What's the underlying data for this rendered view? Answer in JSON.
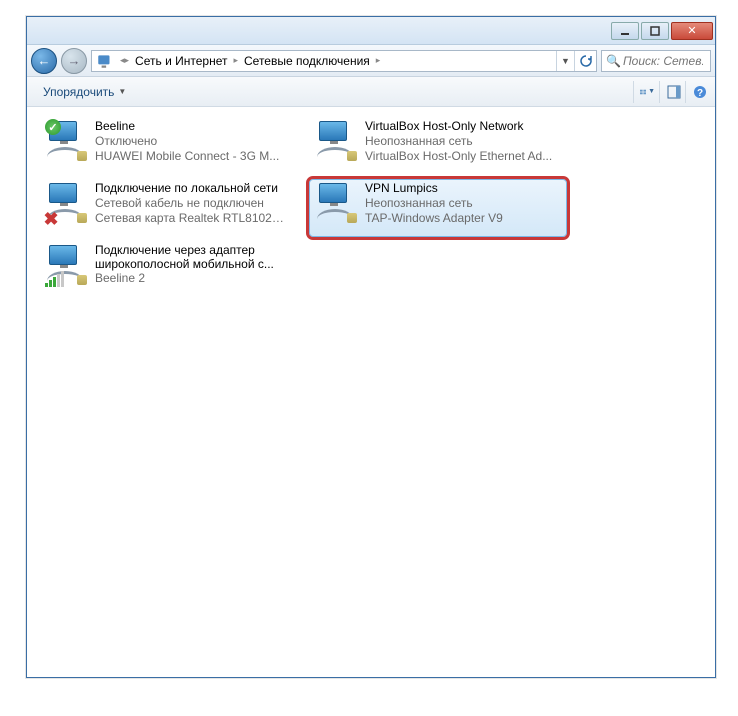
{
  "breadcrumb": {
    "seg1": "Сеть и Интернет",
    "seg2": "Сетевые подключения"
  },
  "search": {
    "placeholder": "Поиск: Сетев..."
  },
  "toolbar": {
    "organize": "Упорядочить"
  },
  "connections": [
    {
      "title": "Beeline",
      "sub1": "Отключено",
      "sub2": "HUAWEI Mobile Connect - 3G M...",
      "icon": "net-ok"
    },
    {
      "title": "Подключение по локальной сети",
      "sub1": "Сетевой кабель не подключен",
      "sub2": "Сетевая карта Realtek RTL8102E/...",
      "icon": "net-err"
    },
    {
      "title": "Подключение через адаптер широкополосной мобильной с...",
      "sub1": "Beeline  2",
      "sub2": "",
      "icon": "net-bars"
    },
    {
      "title": "VirtualBox Host-Only Network",
      "sub1": "Неопознанная сеть",
      "sub2": "VirtualBox Host-Only Ethernet Ad...",
      "icon": "net"
    },
    {
      "title": "VPN Lumpics",
      "sub1": "Неопознанная сеть",
      "sub2": "TAP-Windows Adapter V9",
      "icon": "net",
      "selected": true,
      "highlighted": true
    }
  ]
}
